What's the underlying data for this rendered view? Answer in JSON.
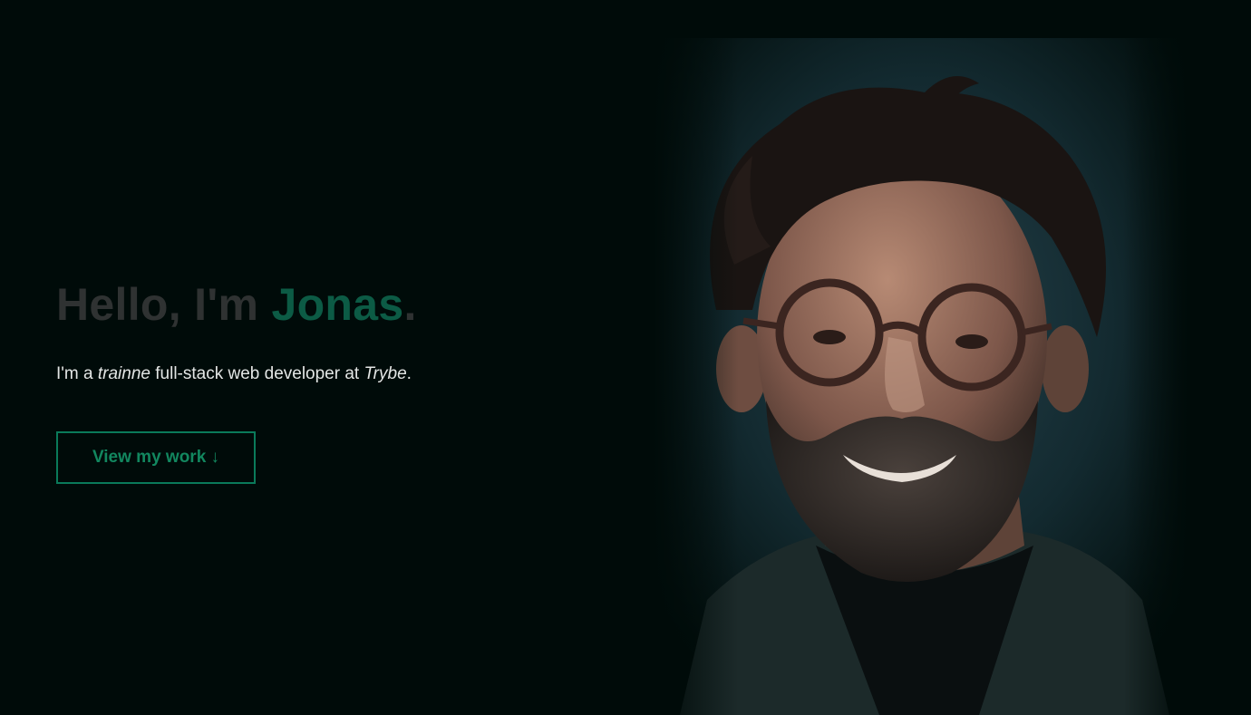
{
  "hero": {
    "greeting_prefix": "Hello, I'm ",
    "name": "Jonas",
    "greeting_suffix": ".",
    "tagline": {
      "part1": "I'm a ",
      "italic1": "trainne",
      "part2": " full-stack web developer at ",
      "italic2": "Trybe",
      "part3": "."
    },
    "cta_label": "View my work ↓"
  },
  "portrait": {
    "description_icon": "portrait-photo"
  },
  "colors": {
    "background": "#000b09",
    "greeting": "#2f3232",
    "accent": "#0c5b45",
    "button_border": "#0a7a5a",
    "button_text": "#12875f",
    "tagline": "#e4e6e5"
  }
}
